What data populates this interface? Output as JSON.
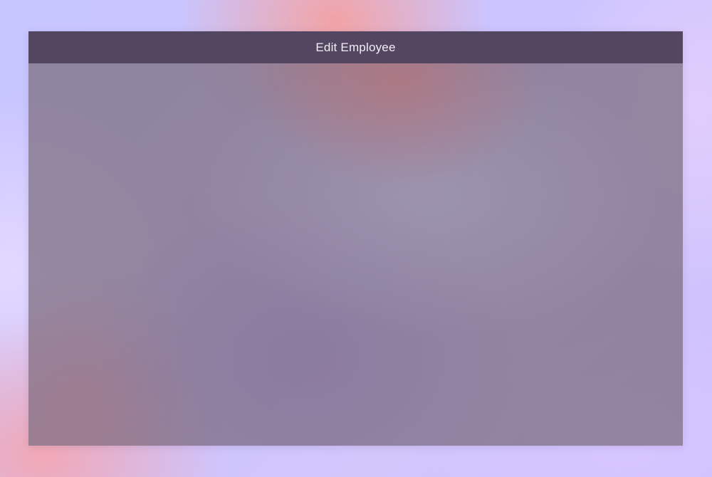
{
  "dialog": {
    "title": "Edit Employee"
  }
}
